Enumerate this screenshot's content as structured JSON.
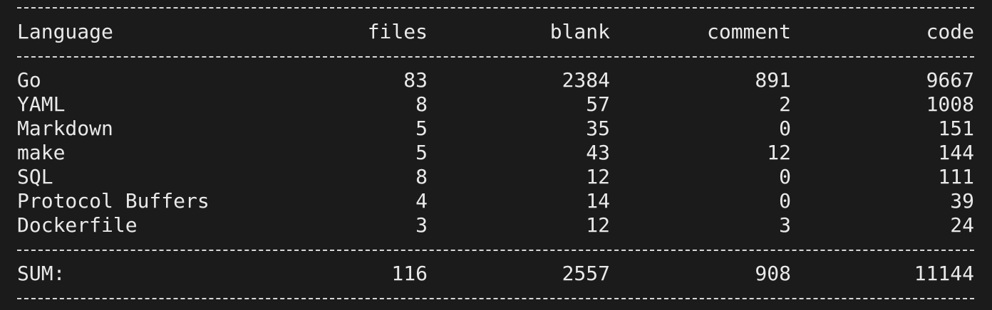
{
  "table": {
    "headers": {
      "language": "Language",
      "files": "files",
      "blank": "blank",
      "comment": "comment",
      "code": "code"
    },
    "rows": [
      {
        "language": "Go",
        "files": "83",
        "blank": "2384",
        "comment": "891",
        "code": "9667"
      },
      {
        "language": "YAML",
        "files": "8",
        "blank": "57",
        "comment": "2",
        "code": "1008"
      },
      {
        "language": "Markdown",
        "files": "5",
        "blank": "35",
        "comment": "0",
        "code": "151"
      },
      {
        "language": "make",
        "files": "5",
        "blank": "43",
        "comment": "12",
        "code": "144"
      },
      {
        "language": "SQL",
        "files": "8",
        "blank": "12",
        "comment": "0",
        "code": "111"
      },
      {
        "language": "Protocol Buffers",
        "files": "4",
        "blank": "14",
        "comment": "0",
        "code": "39"
      },
      {
        "language": "Dockerfile",
        "files": "3",
        "blank": "12",
        "comment": "3",
        "code": "24"
      }
    ],
    "sum": {
      "language": "SUM:",
      "files": "116",
      "blank": "2557",
      "comment": "908",
      "code": "11144"
    }
  },
  "colors": {
    "background": "#1b1b1b",
    "foreground": "#e9e9e9"
  }
}
